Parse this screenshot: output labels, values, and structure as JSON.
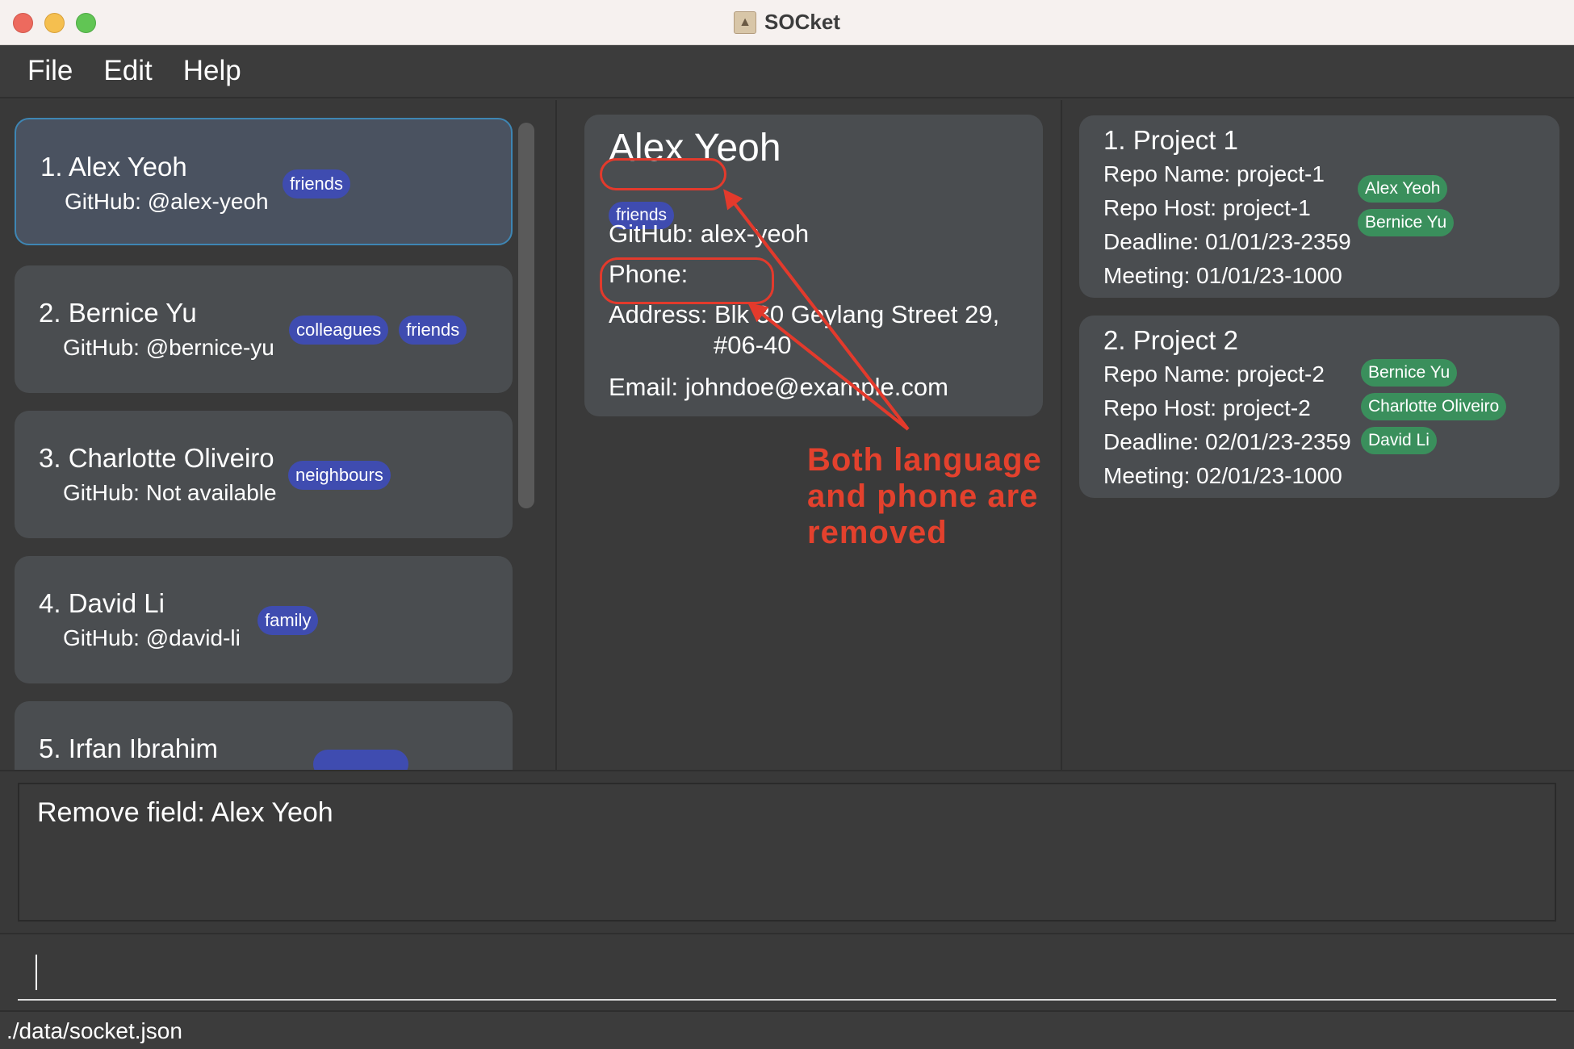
{
  "window": {
    "title": "SOCket"
  },
  "menu": [
    "File",
    "Edit",
    "Help"
  ],
  "persons": [
    {
      "name": "1.  Alex Yeoh",
      "github": "GitHub: @alex-yeoh",
      "tags": [
        "friends"
      ]
    },
    {
      "name": "2.  Bernice Yu",
      "github": "GitHub: @bernice-yu",
      "tags": [
        "colleagues",
        "friends"
      ]
    },
    {
      "name": "3.  Charlotte Oliveiro",
      "github": "GitHub: Not available",
      "tags": [
        "neighbours"
      ]
    },
    {
      "name": "4.  David Li",
      "github": "GitHub: @david-li",
      "tags": [
        "family"
      ]
    },
    {
      "name": "5.  Irfan Ibrahim"
    }
  ],
  "detail": {
    "name": "Alex Yeoh",
    "tag": "friends",
    "github": "GitHub:  alex-yeoh",
    "phone": "Phone:",
    "address_line1": "Address: Blk 30 Geylang Street 29,",
    "address_line2": "#06-40",
    "email": "Email: johndoe@example.com"
  },
  "annotation": {
    "line1": "Both language",
    "line2": "and phone are",
    "line3": "removed",
    "color": "#e3412d"
  },
  "projects": [
    {
      "title": "1.  Project 1",
      "repo_name": "Repo Name: project-1",
      "repo_host": "Repo Host: project-1",
      "deadline": "Deadline: 01/01/23-2359",
      "meeting": "Meeting: 01/01/23-1000",
      "members": [
        "Alex Yeoh",
        "Bernice Yu"
      ]
    },
    {
      "title": "2.  Project 2",
      "repo_name": "Repo Name: project-2",
      "repo_host": "Repo Host: project-2",
      "deadline": "Deadline: 02/01/23-2359",
      "meeting": "Meeting: 02/01/23-1000",
      "members": [
        "Bernice Yu",
        "Charlotte Oliveiro",
        "David Li"
      ]
    }
  ],
  "result": {
    "text": "Remove field: Alex Yeoh"
  },
  "command": {
    "value": ""
  },
  "status": {
    "path": "./data/socket.json"
  },
  "colors": {
    "tag_person": "#3f4cb0",
    "tag_member": "#3a8f5c",
    "selected_border": "#3e86b4"
  }
}
